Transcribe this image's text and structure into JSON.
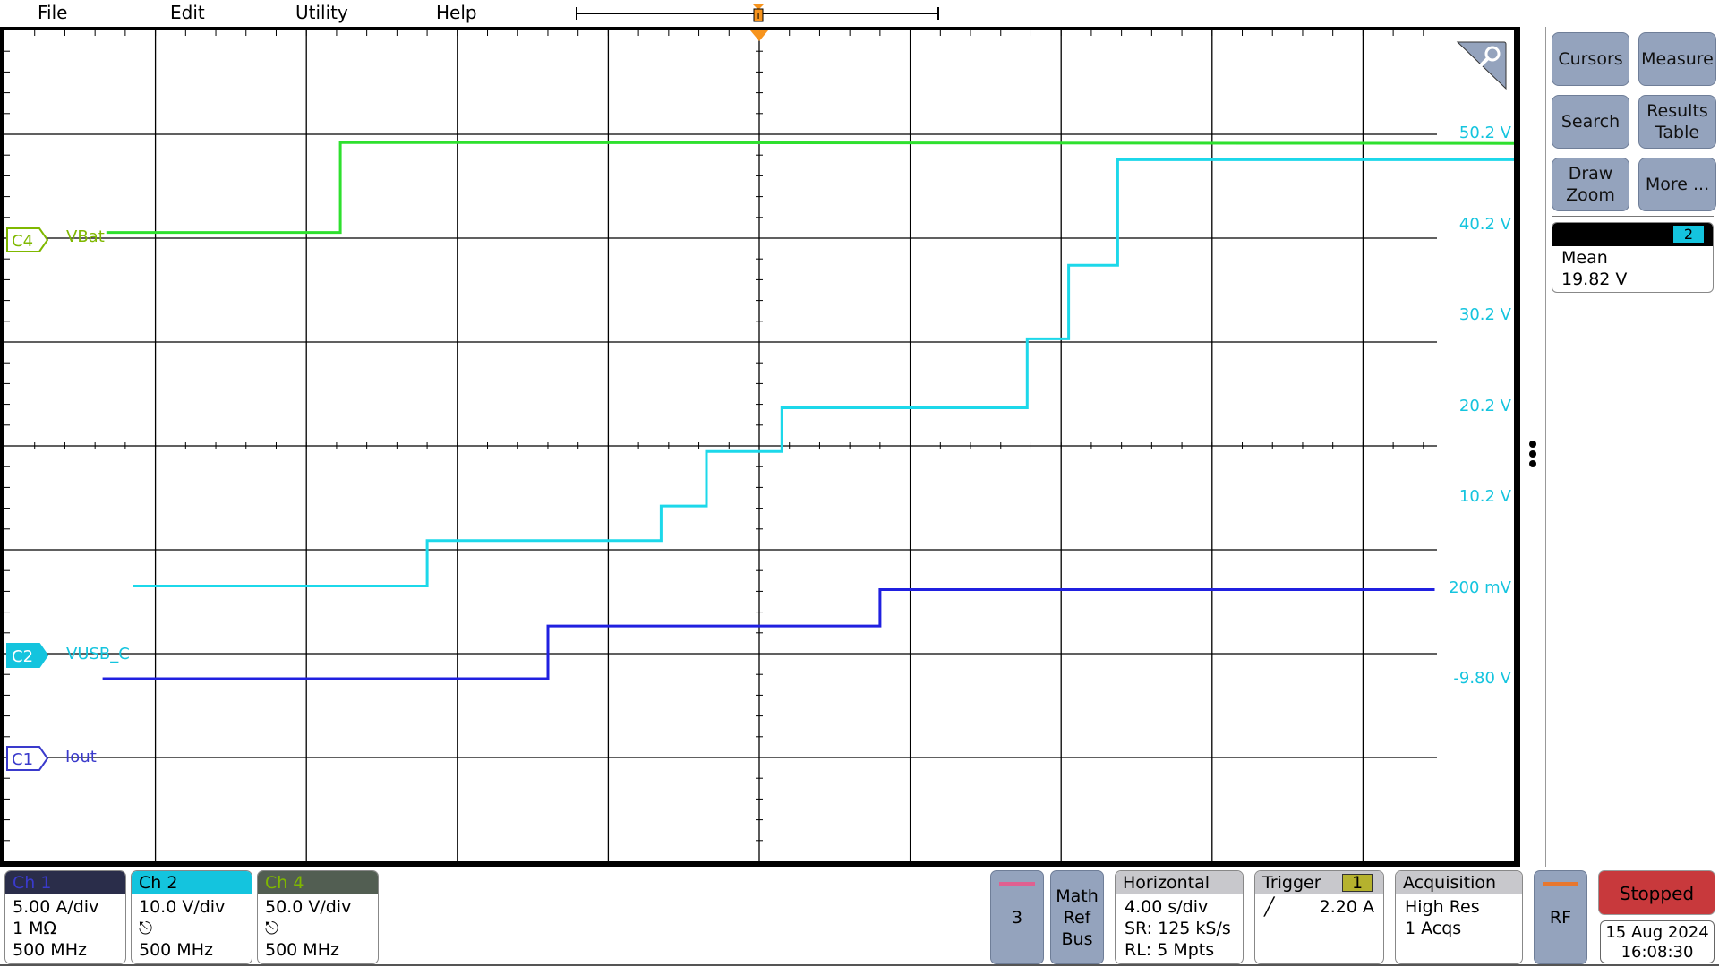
{
  "menu": {
    "items": [
      "File",
      "Edit",
      "Utility",
      "Help"
    ]
  },
  "overview": {
    "trigger_marker": "T"
  },
  "colors": {
    "ch1": "#2020e0",
    "ch2": "#1cd8ea",
    "ch4": "#2ee02e",
    "ch1_label": "#3a3acc",
    "ch2_label": "#14c4de",
    "ch4_label": "#7fb800",
    "trigger": "#f7941d",
    "stopped": "#c8393c",
    "button": "#94a3bd"
  },
  "chart_data": {
    "type": "line",
    "xlim": [
      -20,
      20
    ],
    "ylim": [
      -29.8,
      50.2
    ],
    "grid": true,
    "right_axis_ticks": [
      "50.2 V",
      "40.2 V",
      "30.2 V",
      "20.2 V",
      "10.2 V",
      "200 mV",
      "-9.80 V"
    ],
    "right_axis_tick_values": [
      50.2,
      40.2,
      30.2,
      20.2,
      10.2,
      0.2,
      -9.8
    ],
    "series": [
      {
        "name": "VBat",
        "channel": "C4",
        "color": "#2ee02e",
        "points": [
          [
            -17.3,
            39.4
          ],
          [
            -11.1,
            39.4
          ],
          [
            -11.1,
            49.3
          ],
          [
            20,
            49.2
          ]
        ]
      },
      {
        "name": "VUSB_C",
        "channel": "C2",
        "color": "#1cd8ea",
        "points": [
          [
            -16.6,
            0.5
          ],
          [
            -8.8,
            0.5
          ],
          [
            -8.8,
            5.5
          ],
          [
            -2.6,
            5.5
          ],
          [
            -2.6,
            9.3
          ],
          [
            -1.4,
            9.3
          ],
          [
            -1.4,
            15.3
          ],
          [
            0.6,
            15.3
          ],
          [
            0.6,
            20.1
          ],
          [
            7.1,
            20.1
          ],
          [
            7.1,
            27.7
          ],
          [
            8.2,
            27.7
          ],
          [
            8.2,
            35.8
          ],
          [
            9.5,
            35.8
          ],
          [
            9.5,
            47.4
          ],
          [
            20,
            47.4
          ]
        ]
      },
      {
        "name": "Iout",
        "channel": "C1",
        "color": "#2020e0",
        "points": [
          [
            -17.4,
            -9.7
          ],
          [
            -5.6,
            -9.7
          ],
          [
            -5.6,
            -3.9
          ],
          [
            3.2,
            -3.9
          ],
          [
            3.2,
            0.1
          ],
          [
            17.9,
            0.1
          ]
        ]
      }
    ]
  },
  "channel_labels": [
    {
      "tag": "C4",
      "name": "VBat"
    },
    {
      "tag": "C2",
      "name": "VUSB_C"
    },
    {
      "tag": "C1",
      "name": "Iout"
    }
  ],
  "right_panel": {
    "buttons": [
      "Cursors",
      "Measure",
      "Search",
      "Results Table",
      "Draw Zoom",
      "More ..."
    ],
    "measurement": {
      "source": "2",
      "label": "Mean",
      "value": "19.82 V"
    }
  },
  "channels": [
    {
      "title": "Ch 1",
      "lines": [
        "5.00 A/div",
        "1 MΩ",
        "500 MHz"
      ]
    },
    {
      "title": "Ch 2",
      "lines": [
        "10.0 V/div",
        "",
        "500 MHz"
      ]
    },
    {
      "title": "Ch 4",
      "lines": [
        "50.0 V/div",
        "",
        "500 MHz"
      ]
    }
  ],
  "bottom": {
    "add_channel": "3",
    "math_ref_bus": [
      "Math",
      "Ref",
      "Bus"
    ],
    "horizontal": {
      "title": "Horizontal",
      "lines": [
        "4.00 s/div",
        "SR: 125 kS/s",
        "RL: 5 Mpts"
      ]
    },
    "trigger": {
      "title": "Trigger",
      "source": "1",
      "level": "2.20 A"
    },
    "acquisition": {
      "title": "Acquisition",
      "lines": [
        "High Res",
        "1 Acqs"
      ]
    },
    "rf": "RF",
    "status": "Stopped",
    "date": "15 Aug 2024",
    "time": "16:08:30"
  }
}
